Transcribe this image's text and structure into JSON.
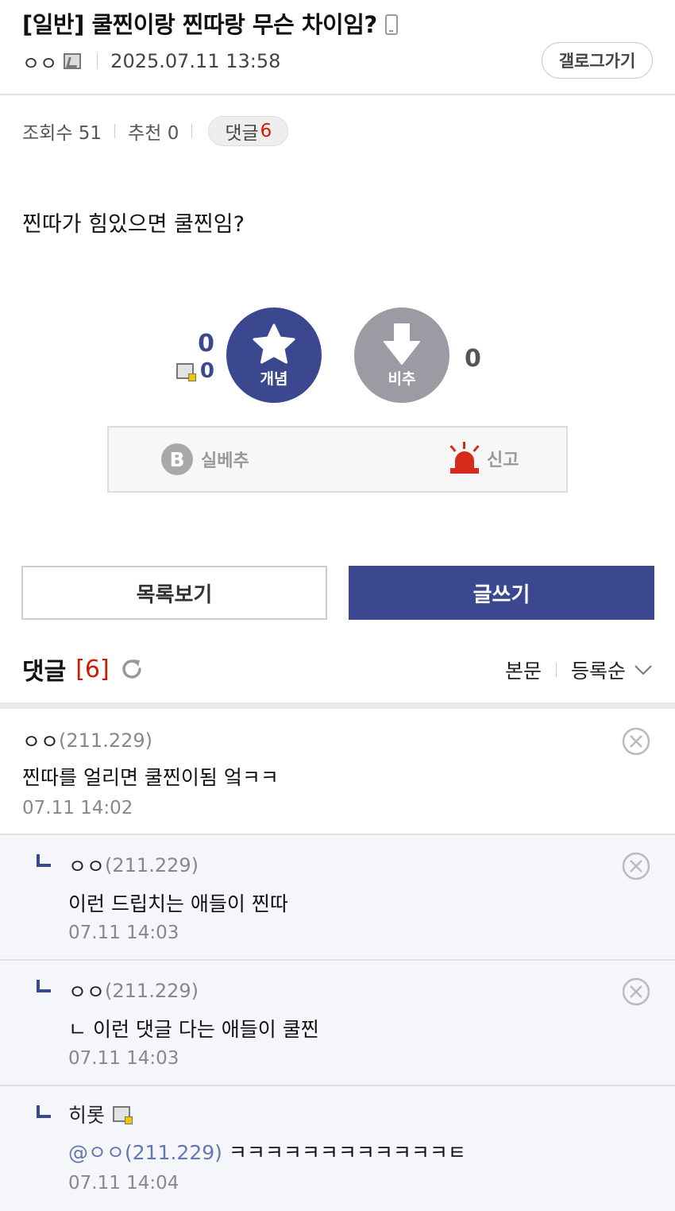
{
  "post": {
    "title": "[일반] 쿨찐이랑 찐따랑 무슨 차이임?",
    "author": "ㅇㅇ",
    "datetime": "2025.07.11 13:58",
    "gallery_button": "갤로그가기",
    "views_label": "조회수 51",
    "recommend_label": "추천 0",
    "comment_label": "댓글",
    "comment_count": "6",
    "body": "찐따가 힘있으면 쿨찐임?"
  },
  "votes": {
    "up_count": "0",
    "fixed_count": "0",
    "up_label": "개념",
    "down_label": "비추",
    "down_count": "0",
    "best_label": "실베추",
    "best_letter": "B",
    "report_label": "신고"
  },
  "buttons": {
    "list_label": "목록보기",
    "write_label": "글쓰기"
  },
  "comments_section": {
    "title": "댓글",
    "count": "[6]",
    "sort_body": "본문",
    "sort_order": "등록순"
  },
  "comments": [
    {
      "author": "ㅇㅇ",
      "ip": "(211.229)",
      "text": "찐따를 얼리면 쿨찐이됨 엌ㅋㅋ",
      "date": "07.11 14:02"
    },
    {
      "author": "ㅇㅇ",
      "ip": "(211.229)",
      "text": "이런 드립치는 애들이 찐따",
      "date": "07.11 14:03"
    },
    {
      "author": "ㅇㅇ",
      "ip": "(211.229)",
      "text": "ㄴ 이런 댓글 다는 애들이 쿨찐",
      "date": "07.11 14:03"
    },
    {
      "author": "히롯",
      "mention": "@ㅇㅇ(211.229)",
      "text": "ㅋㅋㅋㅋㅋㅋㅋㅋㅋㅋㅋㅋㅌ",
      "date": "07.11 14:04"
    }
  ],
  "colors": {
    "brand": "#3b4890",
    "accent_red": "#d31900",
    "downvote_gray": "#9b9ba3",
    "reply_bg": "#f5f6fa"
  }
}
